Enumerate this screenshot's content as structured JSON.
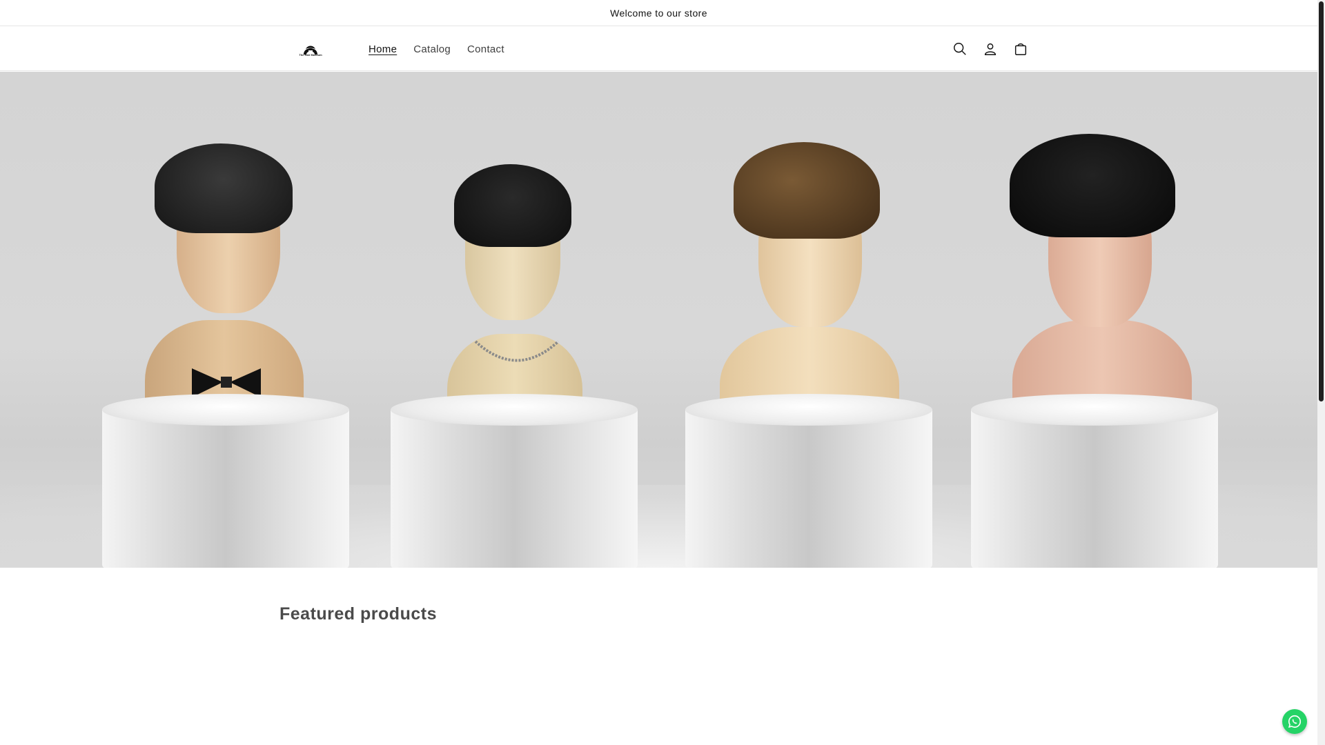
{
  "announcement": {
    "text": "Welcome to our store"
  },
  "header": {
    "logo_text": "The Hair Museum",
    "nav": [
      {
        "label": "Home",
        "active": true
      },
      {
        "label": "Catalog",
        "active": false
      },
      {
        "label": "Contact",
        "active": false
      }
    ],
    "icons": [
      "search-icon",
      "account-icon",
      "cart-icon"
    ]
  },
  "hero": {
    "image_description_icons": [
      "mannequin-bowtie",
      "mannequin-necklace",
      "mannequin-brown-hair",
      "mannequin-dark-hair"
    ]
  },
  "featured": {
    "title": "Featured products"
  },
  "widgets": {
    "chat_icon": "whatsapp-icon"
  },
  "colors": {
    "accent": "#121212",
    "whatsapp": "#25d366",
    "hero_bg": "#d6d6d6"
  }
}
